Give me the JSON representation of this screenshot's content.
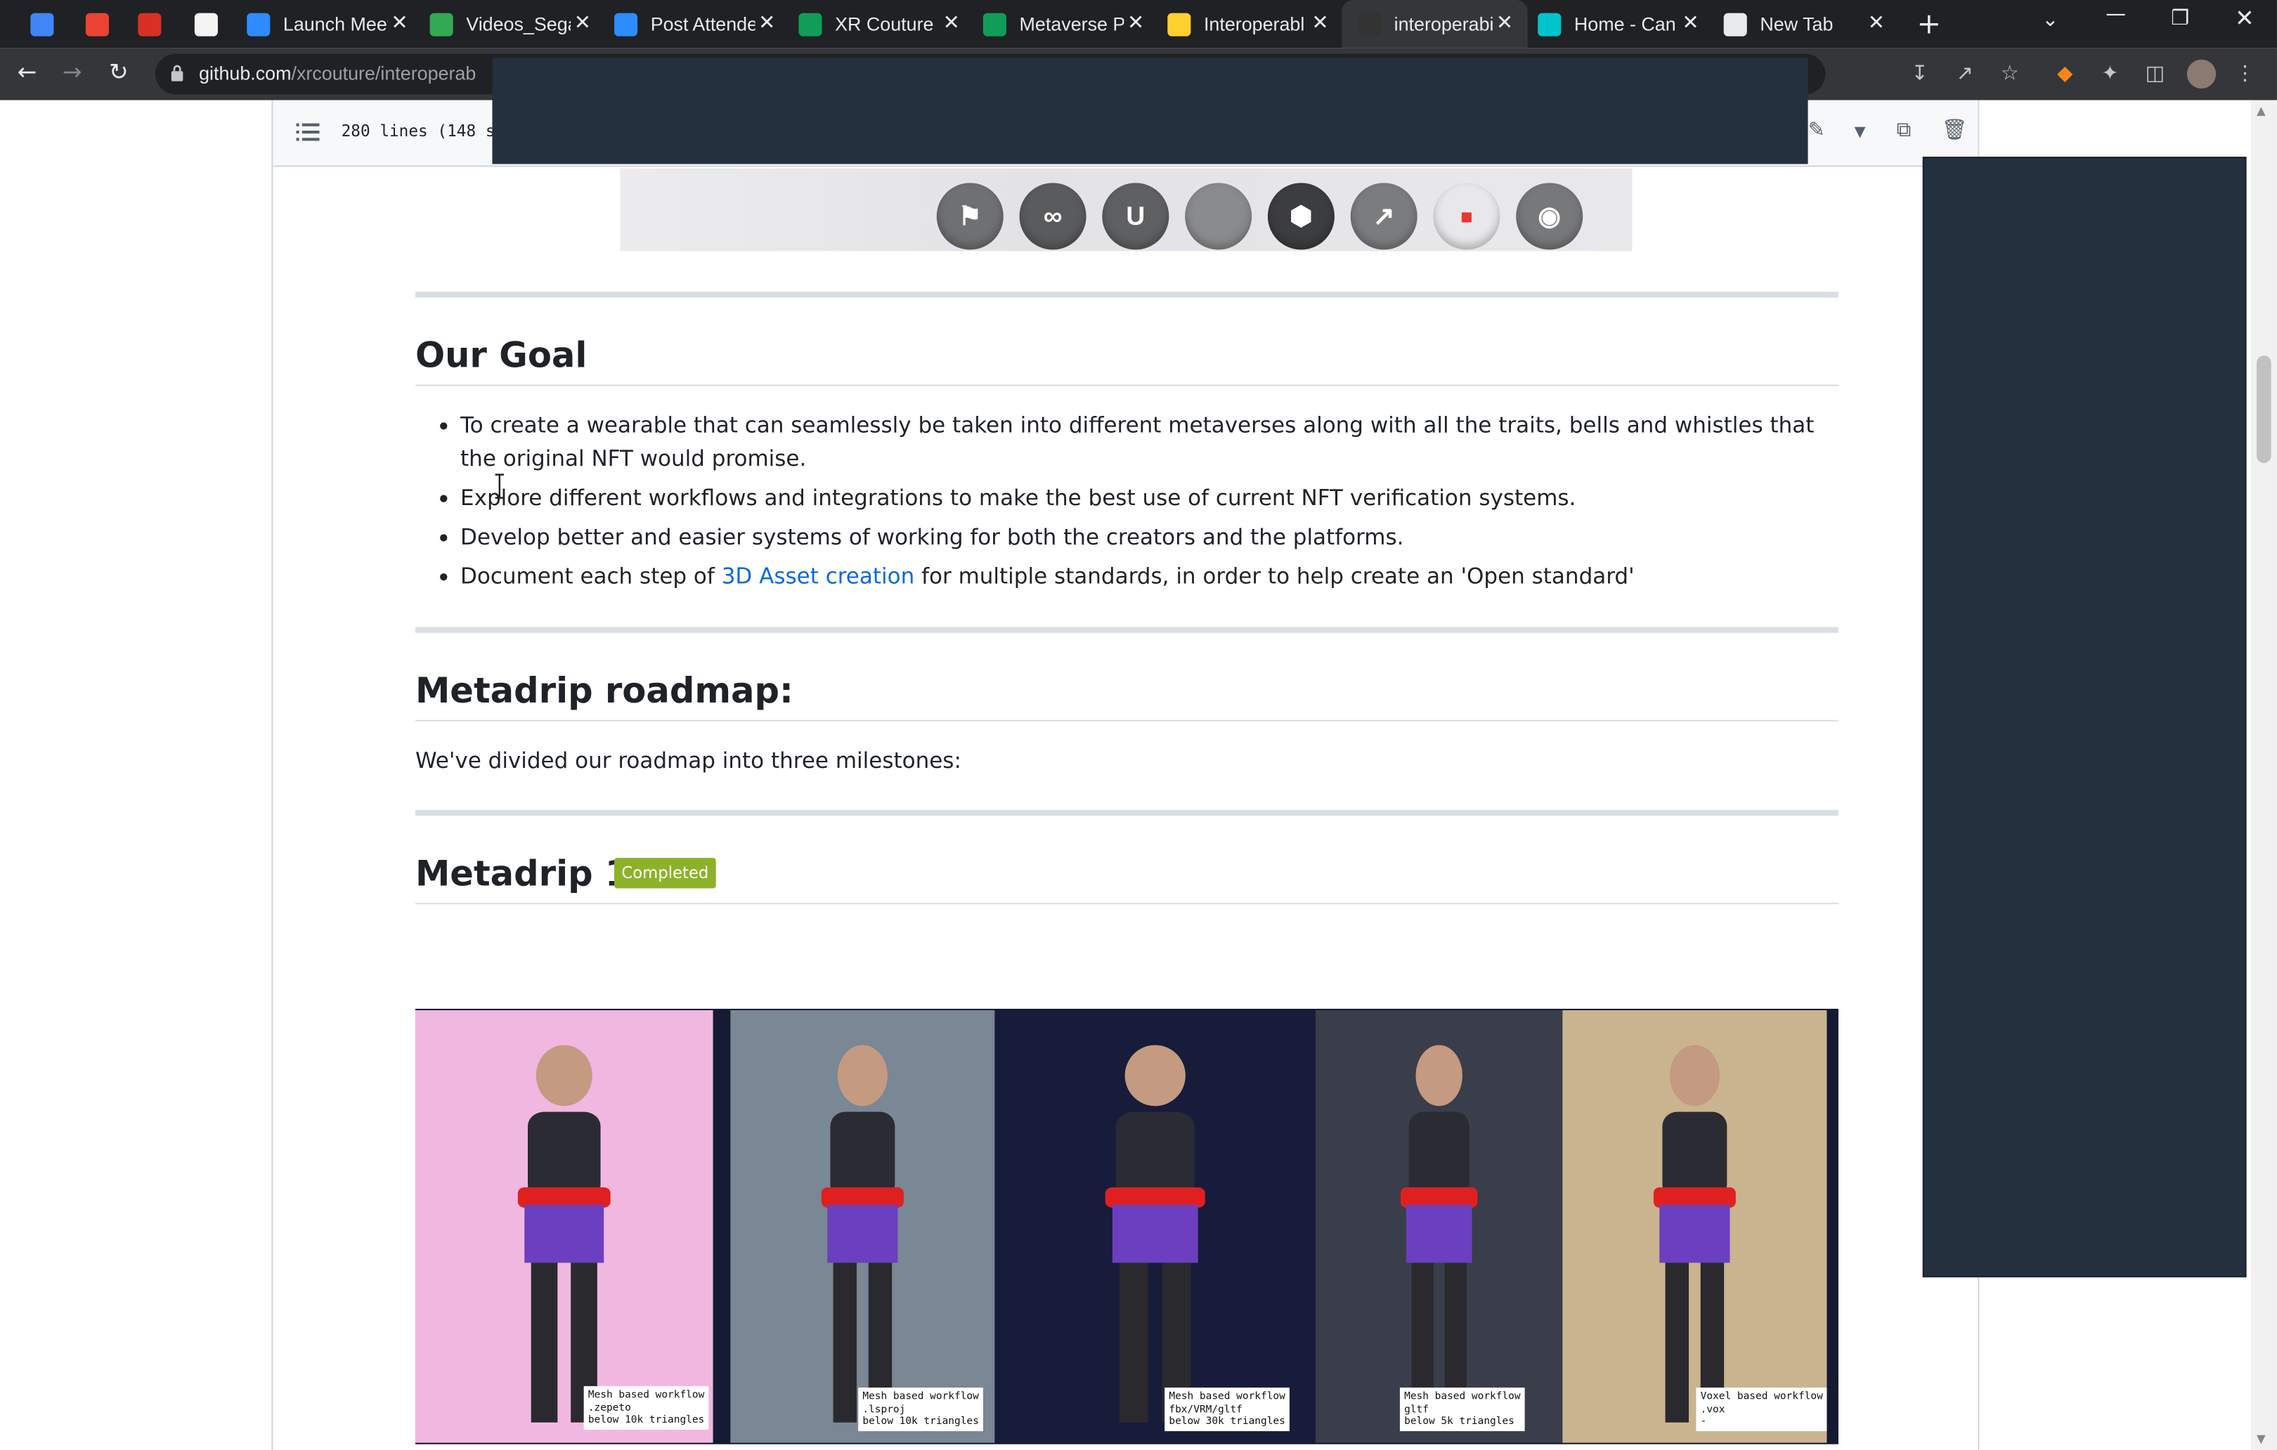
{
  "browser": {
    "tabs": [
      {
        "label": "",
        "icon": "calendar-icon",
        "color": "#4285f4"
      },
      {
        "label": "",
        "icon": "gmail-icon",
        "color": "#ea4335"
      },
      {
        "label": "",
        "icon": "notification-icon",
        "color": "#d93025"
      },
      {
        "label": "",
        "icon": "photo-icon",
        "color": "#f4f4f4"
      },
      {
        "label": "Launch Meet",
        "icon": "zoom-icon",
        "color": "#2d8cff"
      },
      {
        "label": "Videos_Sega",
        "icon": "drive-icon",
        "color": "#34a853"
      },
      {
        "label": "Post Attende",
        "icon": "zoom-icon",
        "color": "#2d8cff"
      },
      {
        "label": "XR Couture",
        "icon": "sheets-icon",
        "color": "#0f9d58"
      },
      {
        "label": "Metaverse P",
        "icon": "sheets-icon",
        "color": "#0f9d58"
      },
      {
        "label": "Interoperabl",
        "icon": "miro-icon",
        "color": "#ffd02f"
      },
      {
        "label": "interoperabi",
        "icon": "github-icon",
        "color": "#333333"
      },
      {
        "label": "Home - Can",
        "icon": "canva-icon",
        "color": "#00c4cc"
      },
      {
        "label": "New Tab",
        "icon": "chrome-icon",
        "color": "#e8eaed"
      }
    ],
    "url_host": "github.com",
    "url_path": "/xrcouture/interoperab"
  },
  "file": {
    "lines_info": "280 lines (148 s"
  },
  "readme": {
    "goal_heading": "Our Goal",
    "goal_items": [
      "To create a wearable that can seamlessly be taken into different metaverses along with all the traits, bells and whistles that the original NFT would promise.",
      "Explore different workflows and integrations to make the best use of current NFT verification systems.",
      "Develop better and easier systems of working for both the creators and the platforms."
    ],
    "goal_item4_pre": "Document each step of ",
    "goal_item4_link": "3D Asset creation",
    "goal_item4_post": " for multiple standards, in order to help create an 'Open standard'",
    "roadmap_heading": "Metadrip roadmap:",
    "roadmap_text": "We've divided our roadmap into three milestones:",
    "milestone_heading": "Metadrip 1.0",
    "milestone_badge": "Completed",
    "platform_logos": [
      "decentraland-logo",
      "infinity-logo",
      "unreal-logo",
      "blank-logo",
      "polygon-logo",
      "sandbox-logo",
      "roblox-logo",
      "cryptovoxels-logo"
    ],
    "avatars": [
      {
        "caption": "Mesh based workflow\n.zepeto\nbelow 10k triangles",
        "bg": "#f0b8e0"
      },
      {
        "caption": "Mesh based workflow\n.lsproj\nbelow 10k triangles",
        "bg": "#7a8794"
      },
      {
        "caption": "Mesh based workflow\nfbx/VRM/gltf\nbelow 30k triangles",
        "bg": "#171c3a"
      },
      {
        "caption": "Mesh based workflow\ngltf\nbelow 5k triangles",
        "bg": "#3a3d4a"
      },
      {
        "caption": "Voxel based workflow\n.vox\n-",
        "bg": "#c9b48f"
      }
    ]
  }
}
